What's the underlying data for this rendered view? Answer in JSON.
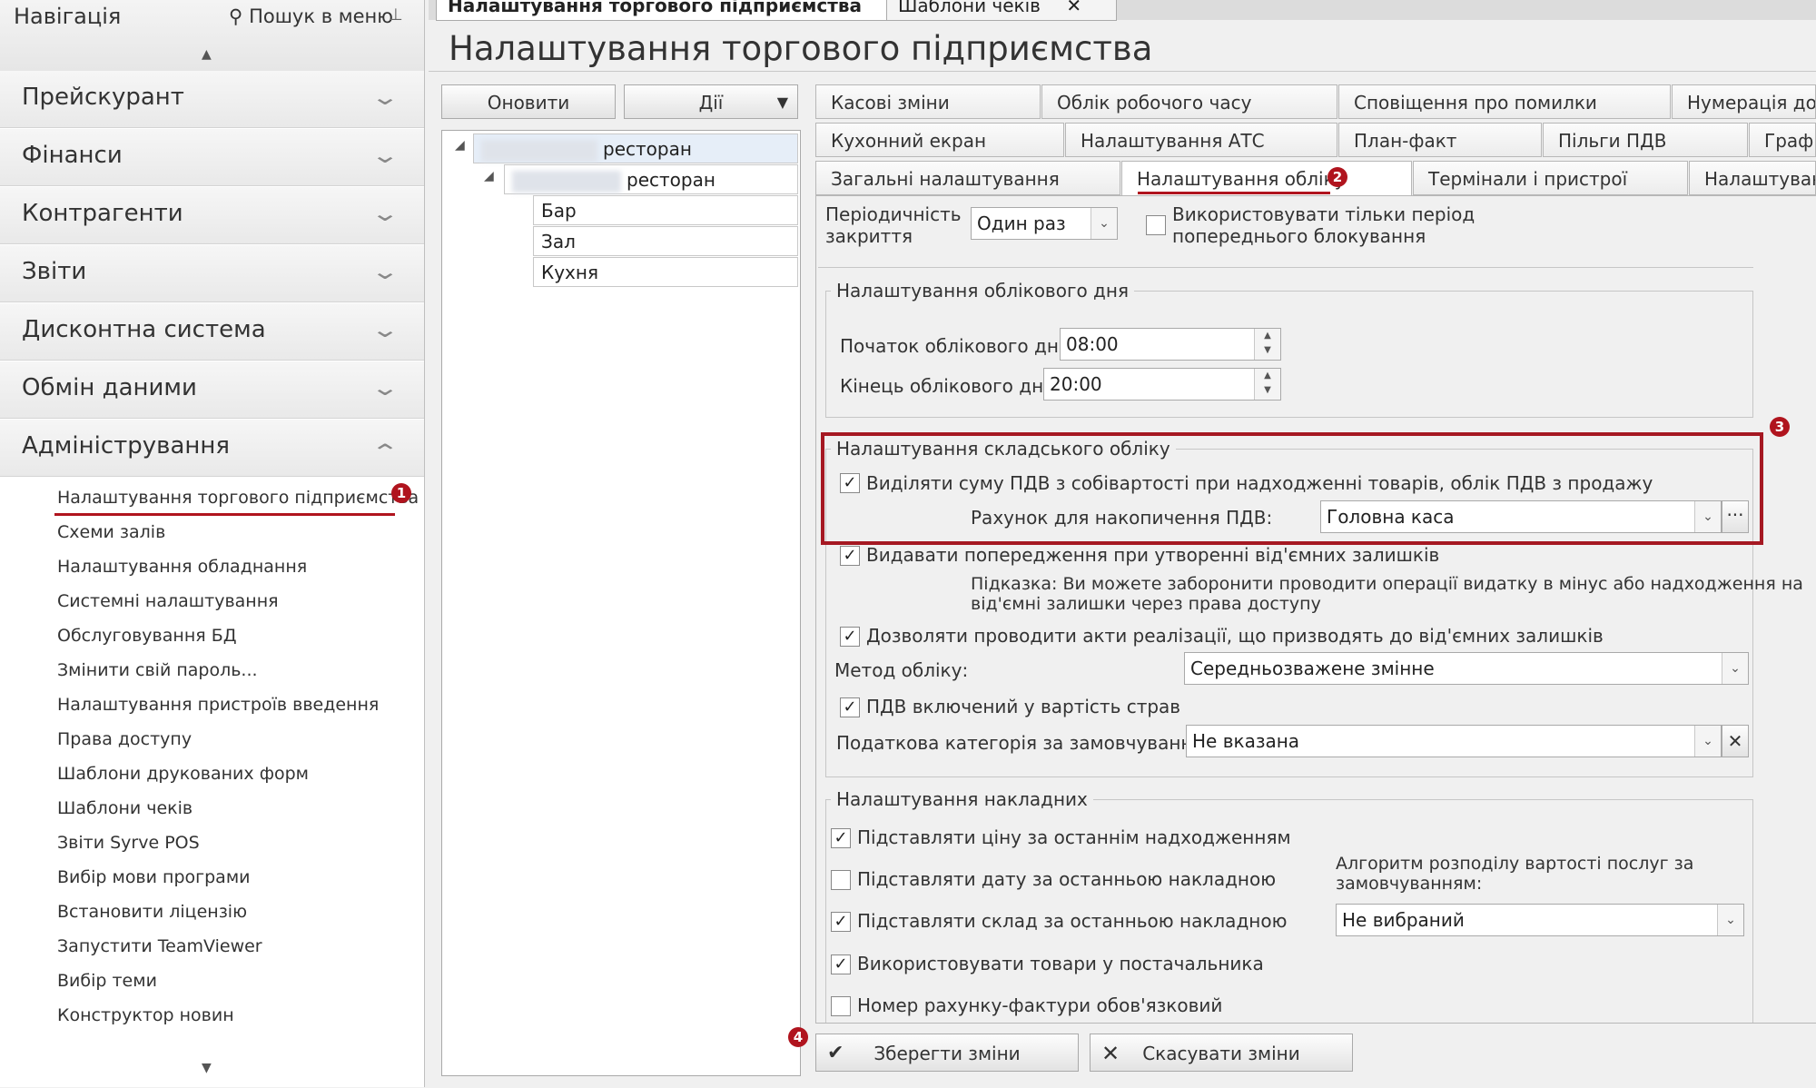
{
  "nav": {
    "title": "Навігація",
    "search_label": "Пошук в меню",
    "sections": [
      {
        "label": "Прейскурант"
      },
      {
        "label": "Фінанси"
      },
      {
        "label": "Контрагенти"
      },
      {
        "label": "Звіти"
      },
      {
        "label": "Дисконтна система"
      },
      {
        "label": "Обмін даними"
      },
      {
        "label": "Адміністрування"
      }
    ],
    "admin_items": [
      {
        "label": "Налаштування торгового підприємства"
      },
      {
        "label": "Схеми залів"
      },
      {
        "label": "Налаштування обладнання"
      },
      {
        "label": "Системні налаштування"
      },
      {
        "label": "Обслуговування БД"
      },
      {
        "label": "Змінити свій пароль..."
      },
      {
        "label": "Налаштування пристроїв введення"
      },
      {
        "label": "Права доступу"
      },
      {
        "label": "Шаблони друкованих форм"
      },
      {
        "label": "Шаблони чеків"
      },
      {
        "label": "Звіти Syrve POS"
      },
      {
        "label": "Вибір мови програми"
      },
      {
        "label": "Встановити ліцензію"
      },
      {
        "label": "Запустити TeamViewer"
      },
      {
        "label": "Вибір теми"
      },
      {
        "label": "Конструктор новин"
      }
    ]
  },
  "doc_tabs": [
    {
      "label": "Налаштування торгового підприємства",
      "close": "✕"
    },
    {
      "label": "Шаблони чеків",
      "close": "✕"
    }
  ],
  "page_title": "Налаштування торгового підприємства",
  "toolbar": {
    "refresh_label": "Оновити",
    "actions_label": "Дії"
  },
  "tree": {
    "nodes": [
      {
        "label": "ресторан"
      },
      {
        "label": "ресторан"
      },
      {
        "label": "Бар"
      },
      {
        "label": "Зал"
      },
      {
        "label": "Кухня"
      }
    ]
  },
  "tabs": {
    "row1": [
      "Касові зміни",
      "Облік робочого часу",
      "Сповіщення про помилки",
      "Нумерація доку"
    ],
    "row2": [
      "Кухонний екран",
      "Налаштування АТС",
      "План-факт",
      "Пільги ПДВ",
      "Графі"
    ],
    "row3": [
      "Загальні налаштування",
      "Налаштування обліку",
      "Термінали і пристрої",
      "Налаштуванн"
    ]
  },
  "close_period": {
    "label_line1": "Періодичність",
    "label_line2": "закриття",
    "value": "Один раз",
    "checkbox_line1": "Використовувати тільки період",
    "checkbox_line2": "попереднього блокування"
  },
  "account_day": {
    "title": "Налаштування облікового дня",
    "start_label": "Початок облікового дня:",
    "start_value": "08:00",
    "end_label": "Кінець облікового дня:",
    "end_value": "20:00"
  },
  "warehouse": {
    "title": "Налаштування складського обліку",
    "vat_checkbox": "Виділяти суму ПДВ з собівартості при надходженні товарів, облік ПДВ з продажу",
    "vat_account_label": "Рахунок для накопичення ПДВ:",
    "vat_account_value": "Головна каса",
    "neg_warning": "Видавати попередження при утворенні від'ємних залишків",
    "hint_line1": "Підказка: Ви можете заборонити проводити операції видатку в мінус або надходження на",
    "hint_line2": "від'ємні залишки через права доступу",
    "allow_acts": "Дозволяти проводити акти реалізації, що призводять до від'ємних залишків",
    "method_label": "Метод обліку:",
    "method_value": "Середньозважене змінне",
    "vat_in_price": "ПДВ включений у вартість страв",
    "tax_label": "Податкова категорія за замовчуванням:",
    "tax_value": "Не вказана"
  },
  "invoices": {
    "title": "Налаштування накладних",
    "opt1": "Підставляти ціну за останнім надходженням",
    "opt2": "Підставляти дату за останньою накладною",
    "opt3": "Підставляти склад за останньою накладною",
    "opt4": "Використовувати товари у постачальника",
    "opt5": "Номер рахунку-фактури обов'язковий",
    "algo_line1": "Алгоритм розподілу вартості послуг за",
    "algo_line2": "замовчуванням:",
    "algo_value": "Не вибраний"
  },
  "buttons": {
    "save": "Зберегти зміни",
    "cancel": "Скасувати зміни"
  },
  "badges": {
    "b1": "1",
    "b2": "2",
    "b3": "3",
    "b4": "4"
  },
  "colors": {
    "accent": "#b0141e"
  }
}
